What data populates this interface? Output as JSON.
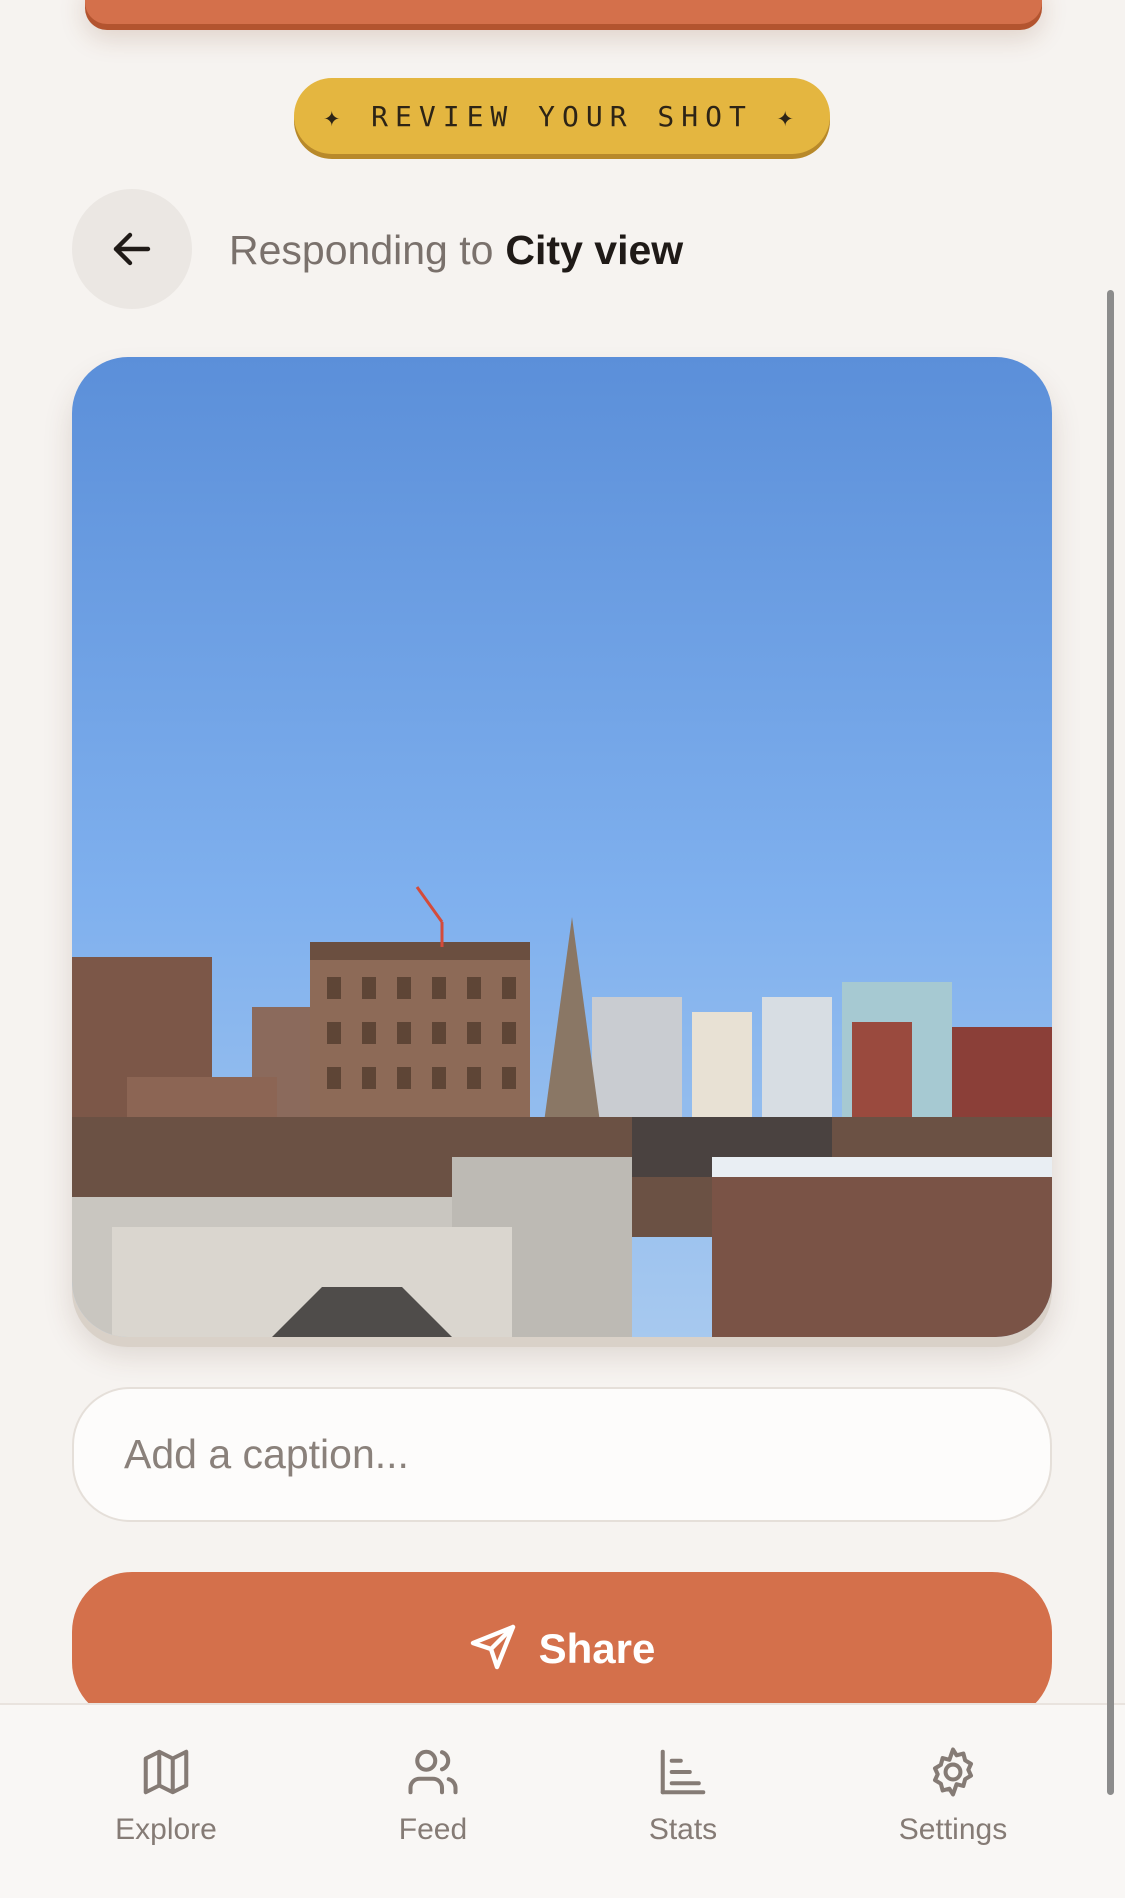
{
  "banner": {
    "text": "✦ REVIEW YOUR SHOT ✦"
  },
  "header": {
    "responding_prefix": "Responding to",
    "responding_target": "City view"
  },
  "photo": {
    "description_icon": "city-skyline-photo"
  },
  "caption": {
    "placeholder": "Add a caption...",
    "value": ""
  },
  "share": {
    "label": "Share",
    "icon": "send-icon"
  },
  "tabs": [
    {
      "label": "Explore",
      "icon": "map-icon"
    },
    {
      "label": "Feed",
      "icon": "users-icon"
    },
    {
      "label": "Stats",
      "icon": "bar-chart-icon"
    },
    {
      "label": "Settings",
      "icon": "gear-icon"
    }
  ],
  "colors": {
    "accent": "#d4704b",
    "badge": "#e4b640",
    "background": "#f6f3f0"
  }
}
